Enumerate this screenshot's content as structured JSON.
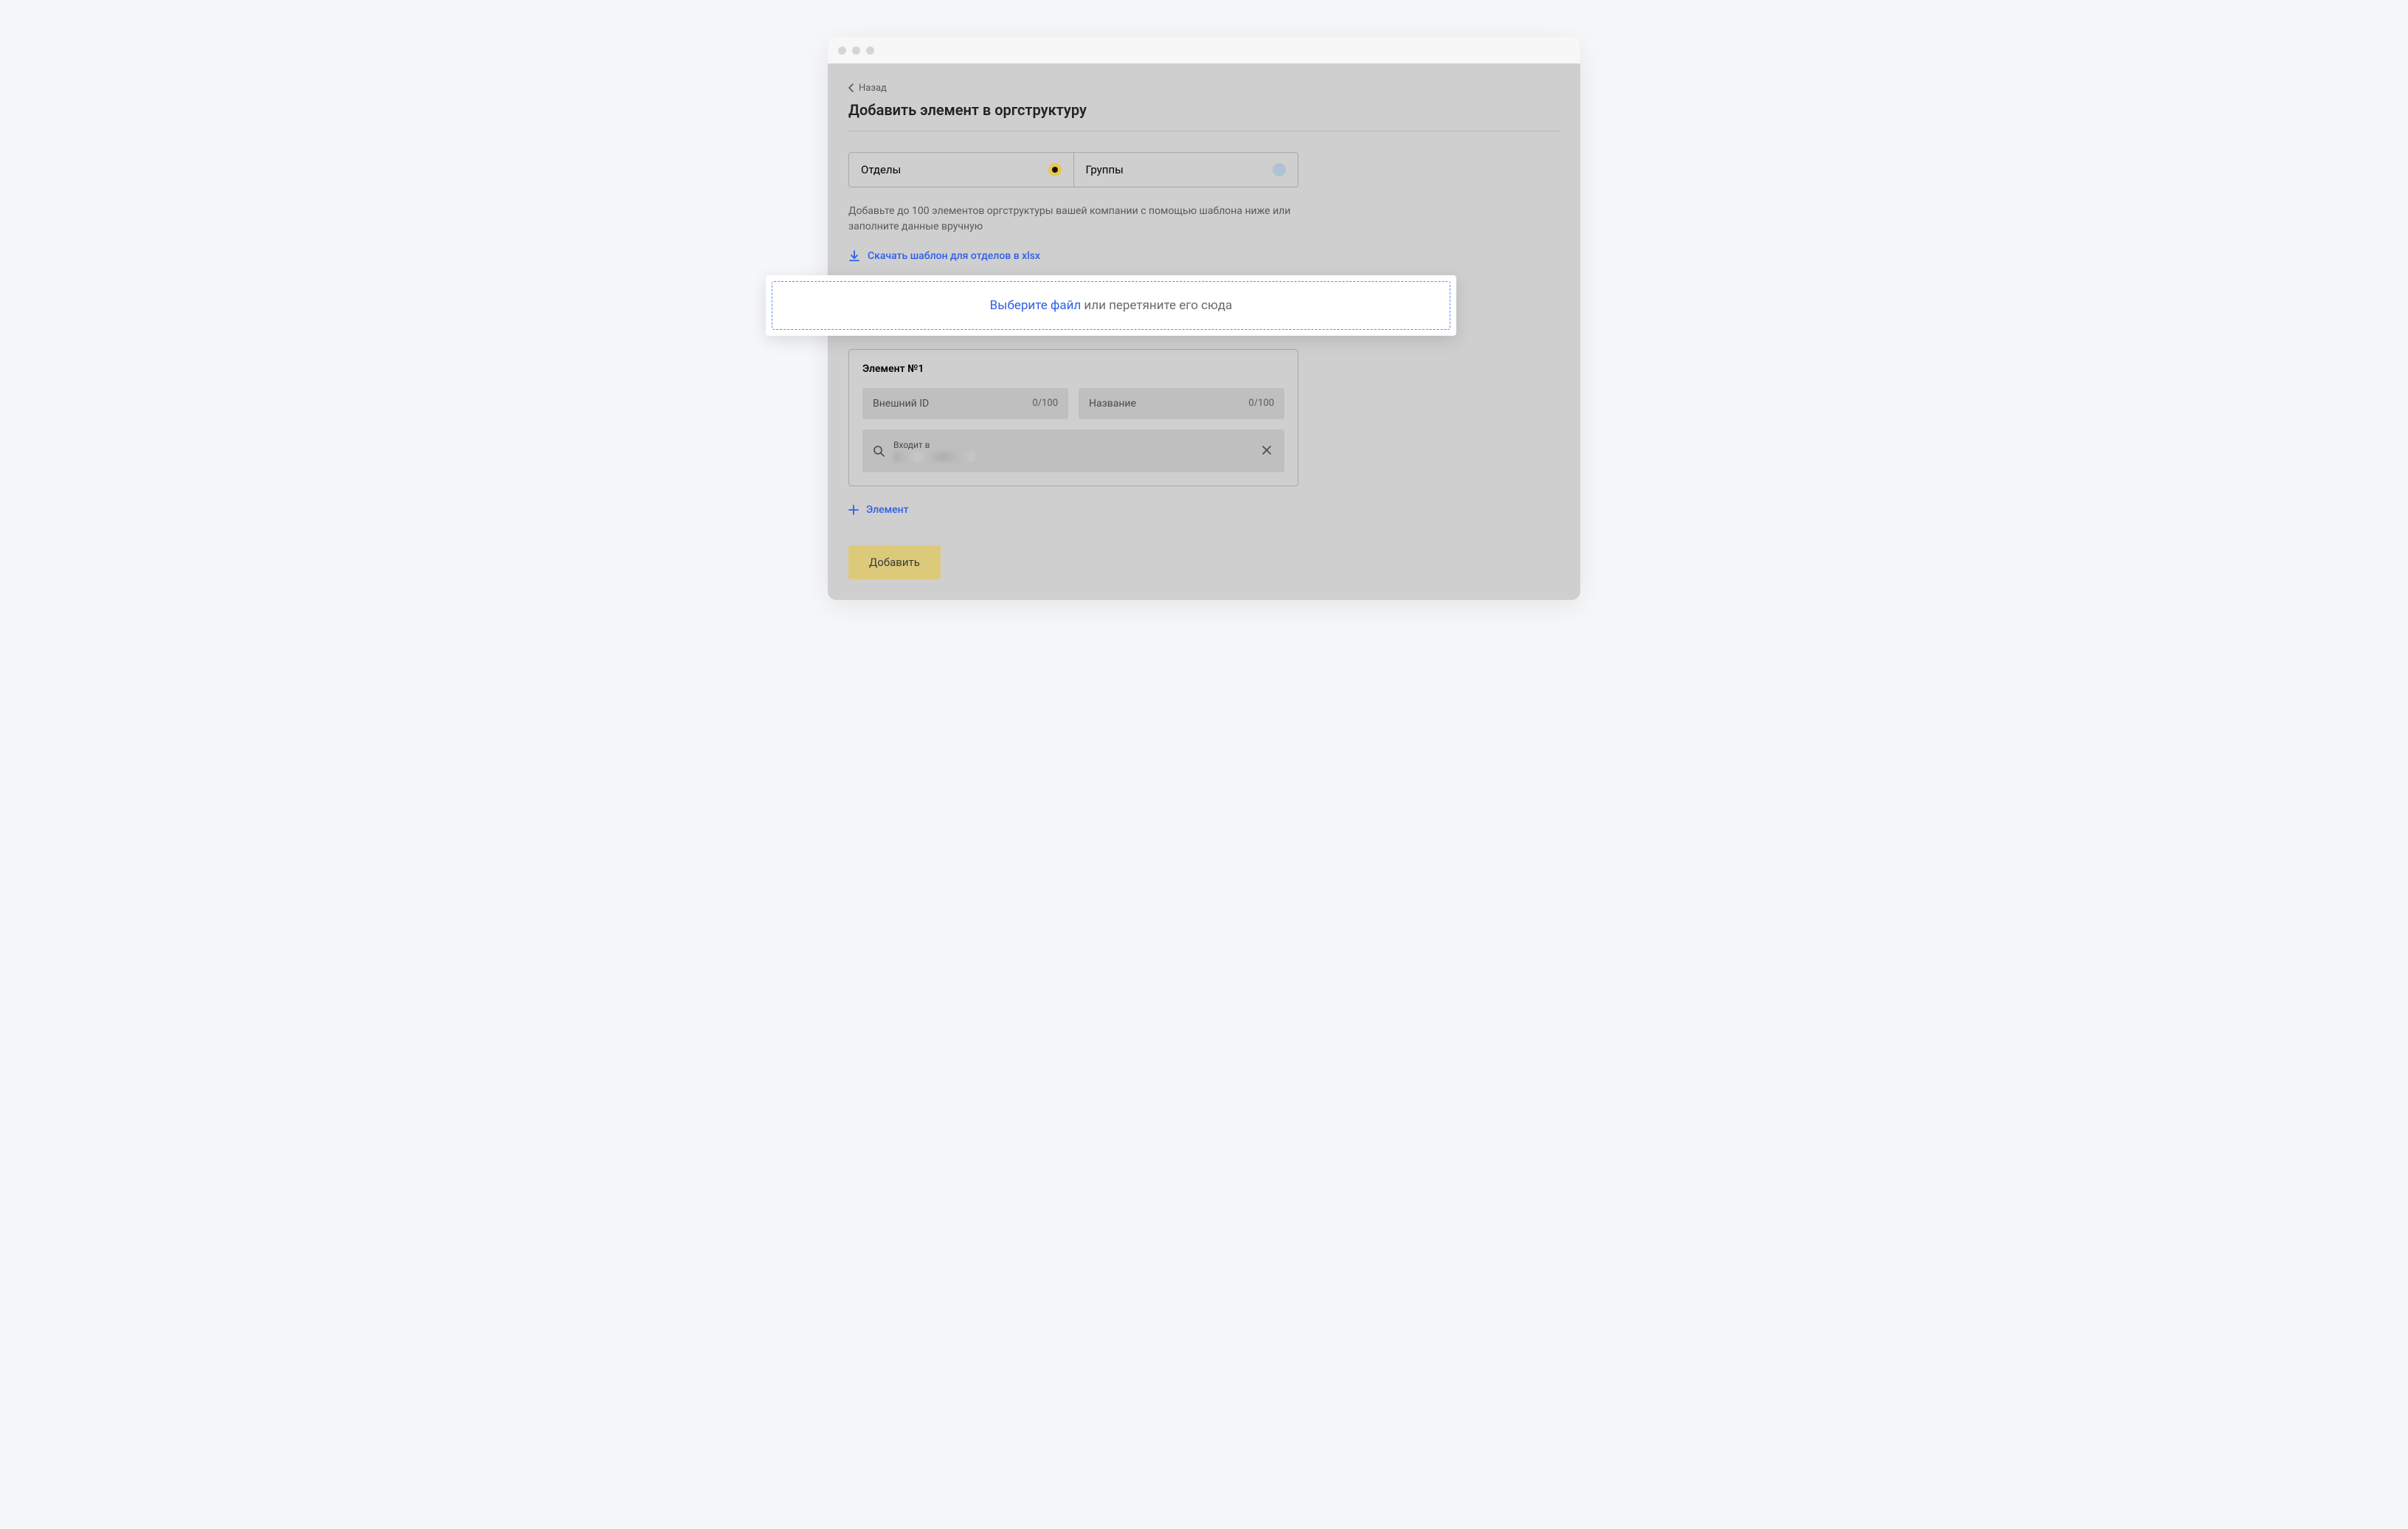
{
  "back_label": "Назад",
  "page_title": "Добавить элемент в оргструктуру",
  "tabs": {
    "departments": "Отделы",
    "groups": "Группы"
  },
  "instruction": "Добавьте до 100 элементов оргструктуры вашей компании с помощью шаблона ниже или заполните данные вручную",
  "download_template_label": "Скачать шаблон для отделов в xlsx",
  "dropzone": {
    "link": "Выберите файл",
    "rest": " или перетяните его сюда"
  },
  "element": {
    "title": "Элемент №1",
    "external_id_label": "Внешний ID",
    "external_id_count": "0/100",
    "name_label": "Название",
    "name_count": "0/100",
    "parent_label": "Входит в"
  },
  "add_element_label": "Элемент",
  "submit_label": "Добавить"
}
